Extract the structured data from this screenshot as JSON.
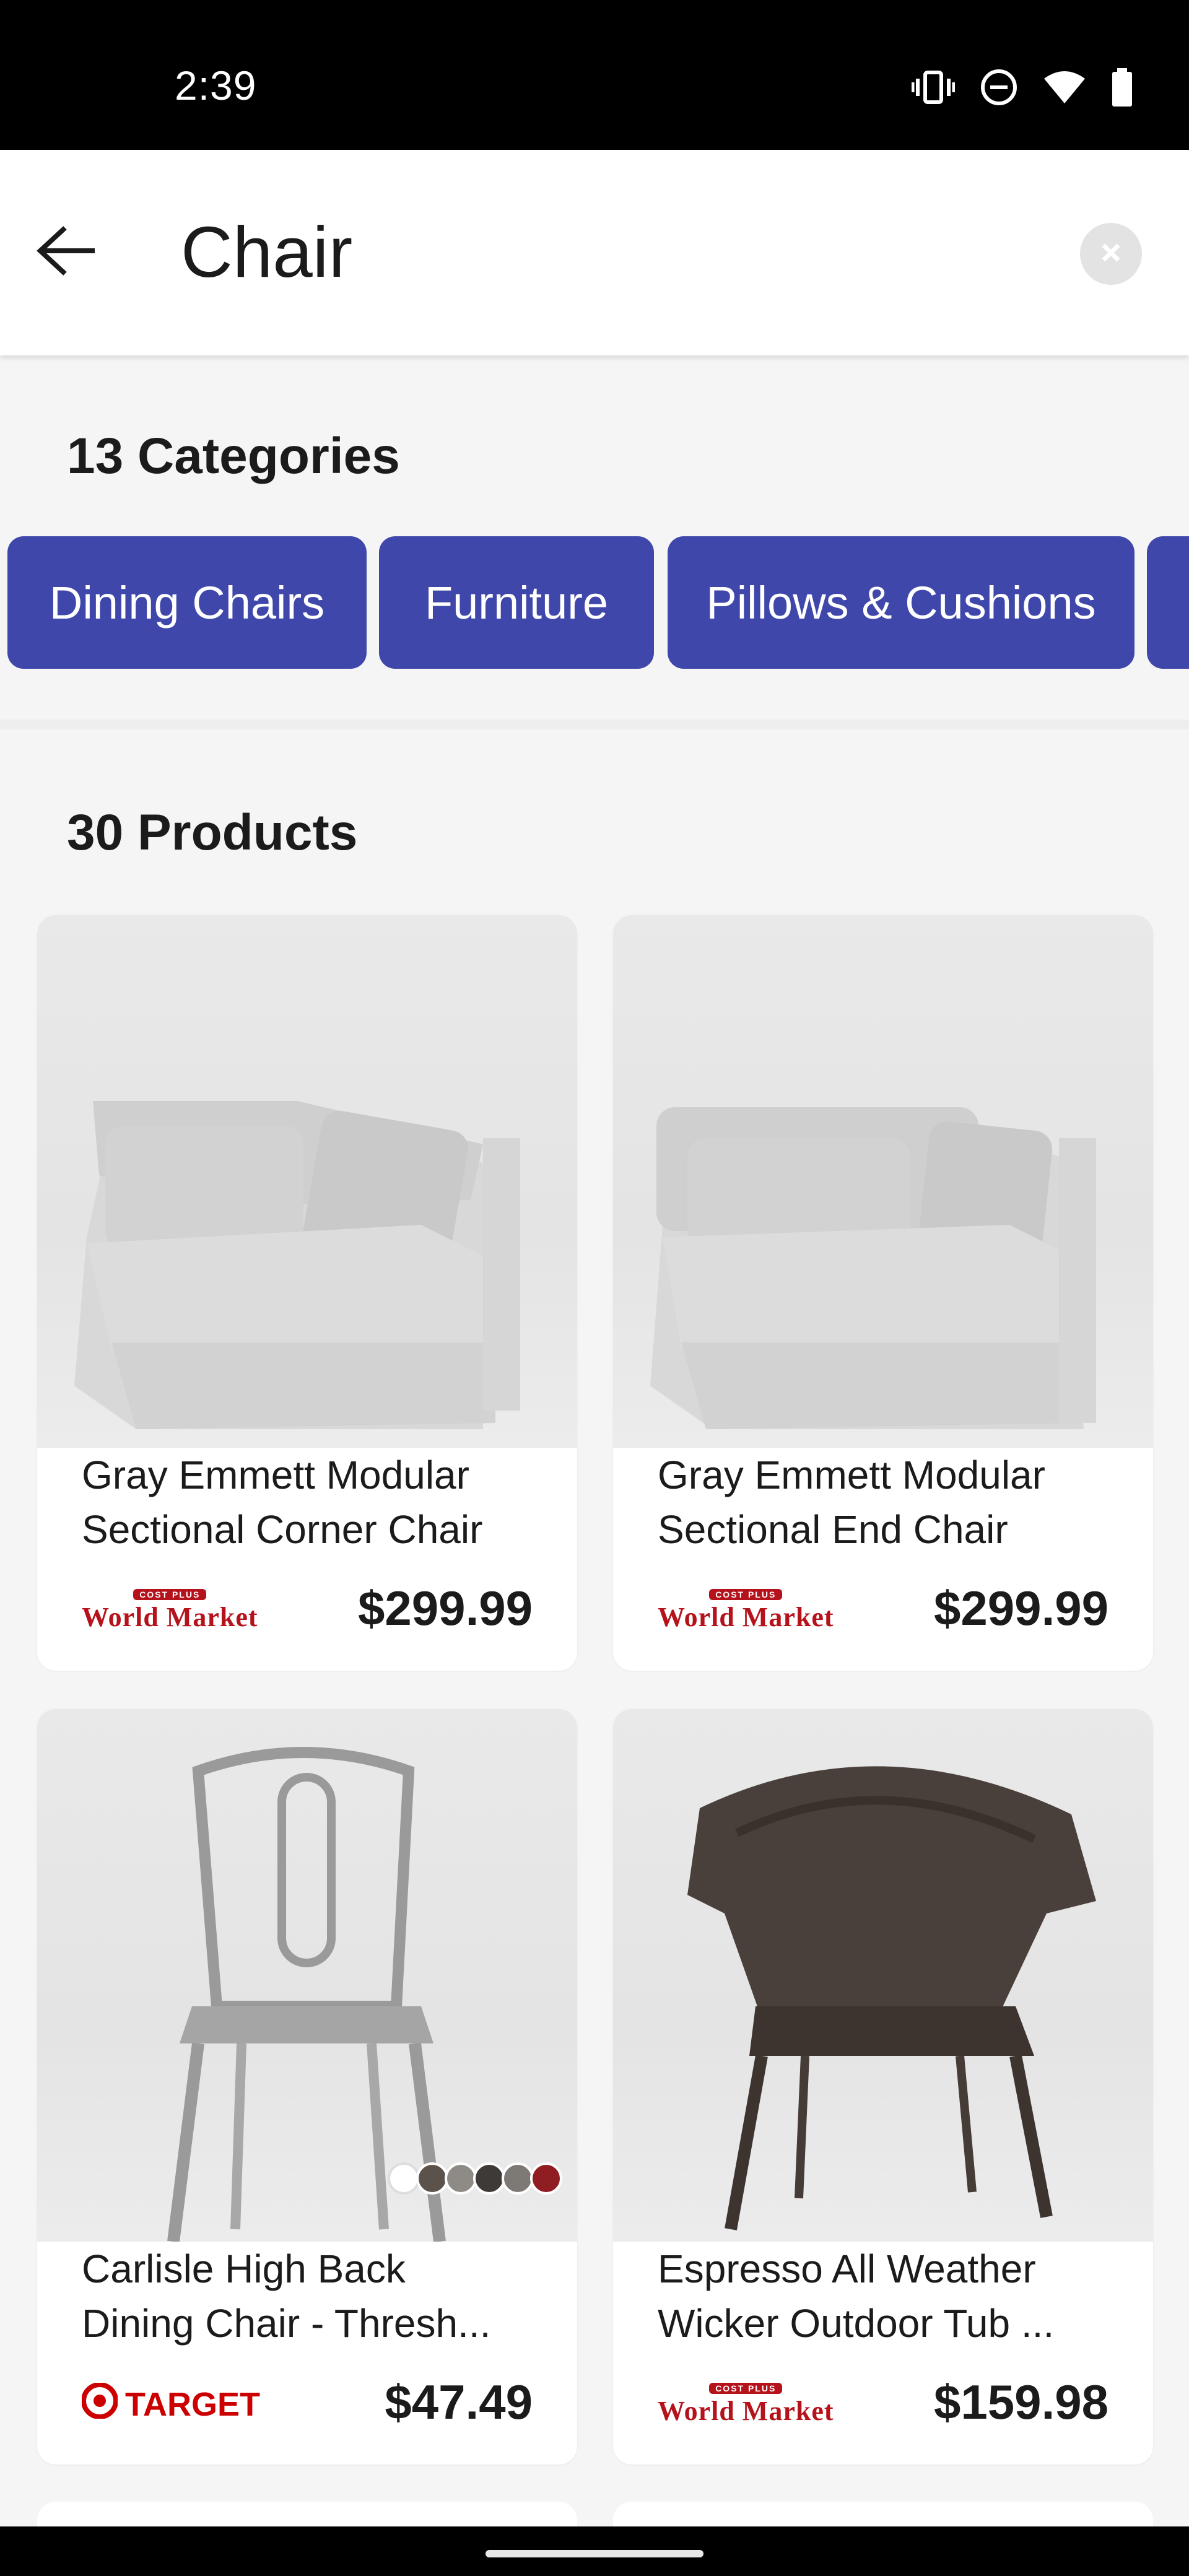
{
  "status_bar": {
    "time": "2:39",
    "icons": [
      "vibrate-icon",
      "do-not-disturb-icon",
      "wifi-icon",
      "battery-icon"
    ]
  },
  "search": {
    "query": "Chair",
    "back_icon": "arrow-left-icon",
    "clear_icon": "close-circle-icon"
  },
  "categories": {
    "heading": "13 Categories",
    "chips": [
      "Dining Chairs",
      "Furniture",
      "Pillows & Cushions"
    ]
  },
  "products": {
    "heading": "30 Products",
    "items": [
      {
        "title_line1": "Gray Emmett Modular",
        "title_line2": "Sectional Corner Chair",
        "retailer": "World Market",
        "retailer_ribbon": "COST PLUS",
        "price": "$299.99"
      },
      {
        "title_line1": "Gray Emmett Modular",
        "title_line2": "Sectional End Chair",
        "retailer": "World Market",
        "retailer_ribbon": "COST PLUS",
        "price": "$299.99"
      },
      {
        "title_line1": "Carlisle High Back",
        "title_line2": "Dining Chair - Thresh...",
        "retailer": "TARGET",
        "price": "$47.49",
        "swatch_colors": [
          "#ffffff",
          "#5b524c",
          "#8e8a86",
          "#3e3a37",
          "#7d7975",
          "#8f1d22"
        ]
      },
      {
        "title_line1": "Espresso All Weather",
        "title_line2": "Wicker Outdoor Tub ...",
        "retailer": "World Market",
        "retailer_ribbon": "COST PLUS",
        "price": "$159.98"
      }
    ]
  },
  "colors": {
    "accent": "#3f48aa",
    "world_market_red": "#b5121b",
    "target_red": "#cc0000"
  }
}
